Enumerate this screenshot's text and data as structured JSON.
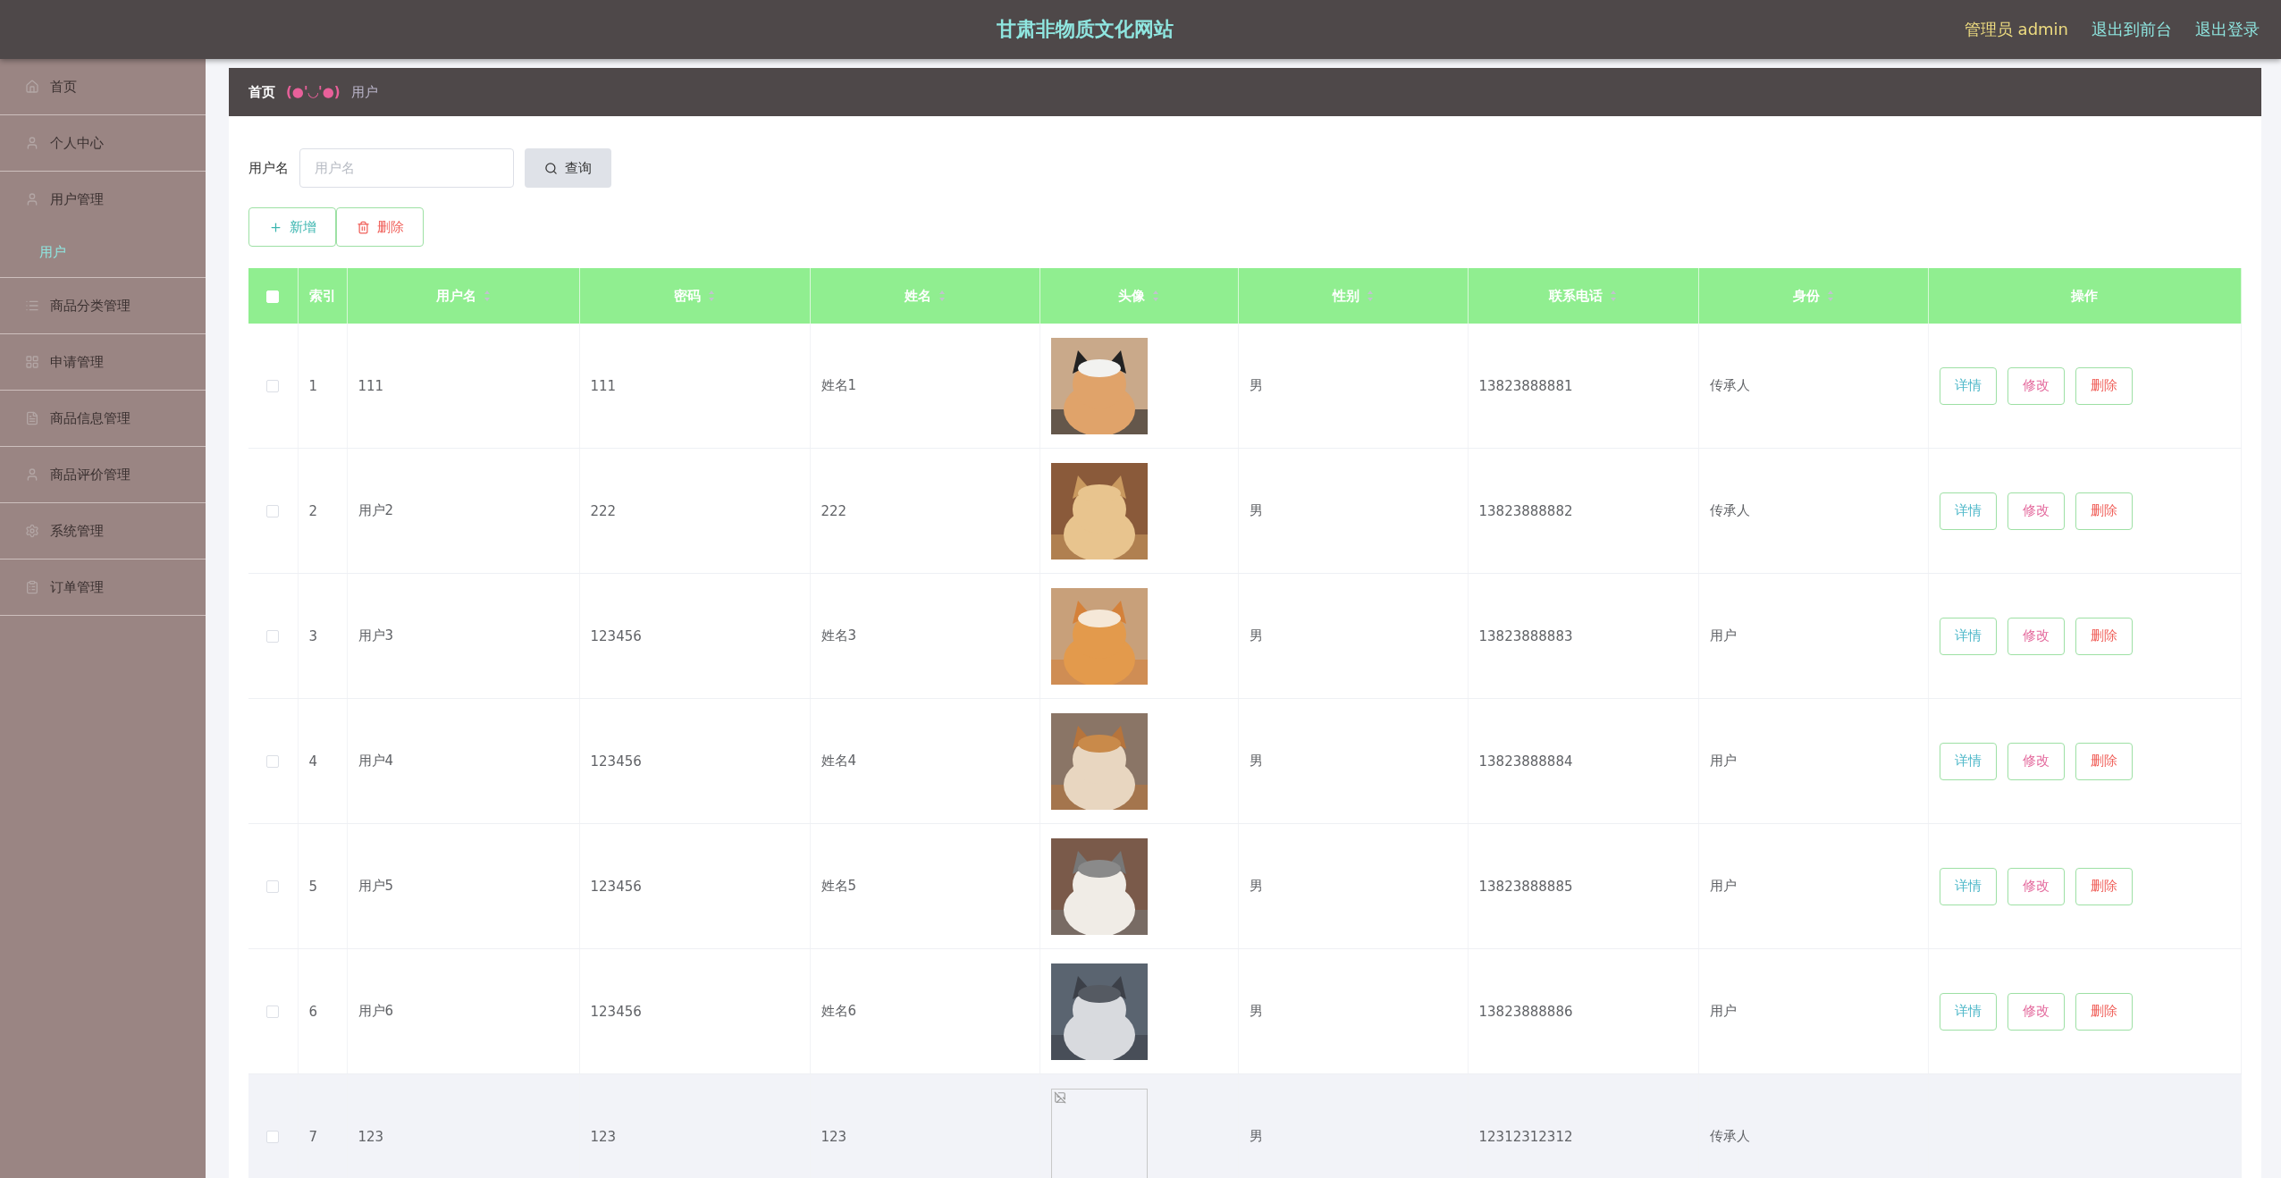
{
  "header": {
    "title": "甘肃非物质文化网站",
    "user": "管理员 admin",
    "links": [
      "退出到前台",
      "退出登录"
    ]
  },
  "sidebar": {
    "items": [
      {
        "label": "首页",
        "selected": false
      },
      {
        "label": "个人中心",
        "selected": false
      },
      {
        "label": "用户管理",
        "selected": false,
        "children": [
          {
            "label": "用户",
            "selected": true
          }
        ]
      },
      {
        "label": "商品分类管理",
        "selected": false
      },
      {
        "label": "申请管理",
        "selected": false
      },
      {
        "label": "商品信息管理",
        "selected": false
      },
      {
        "label": "商品评价管理",
        "selected": false
      },
      {
        "label": "系统管理",
        "selected": false
      },
      {
        "label": "订单管理",
        "selected": false
      }
    ]
  },
  "breadcrumb": {
    "home": "首页",
    "emoticon": "(●'◡'●)",
    "current": "用户"
  },
  "search": {
    "label": "用户名",
    "placeholder": "用户名",
    "button": "查询"
  },
  "toolbar": [
    {
      "kind": "add",
      "label": "新增"
    },
    {
      "kind": "delete",
      "label": "删除"
    }
  ],
  "table": {
    "select_all": {
      "checked": false
    },
    "columns": [
      {
        "label": "索引",
        "sortable": false
      },
      {
        "label": "用户名",
        "sortable": true
      },
      {
        "label": "密码",
        "sortable": true
      },
      {
        "label": "姓名",
        "sortable": true
      },
      {
        "label": "头像",
        "sortable": true
      },
      {
        "label": "性别",
        "sortable": true
      },
      {
        "label": "联系电话",
        "sortable": true
      },
      {
        "label": "身份",
        "sortable": true
      },
      {
        "label": "操作",
        "sortable": false
      }
    ],
    "rows": [
      {
        "checked": false,
        "hovered": false,
        "index": "1",
        "username": "111",
        "password": "111",
        "name": "姓名1",
        "gender": "男",
        "phone": "13823888881",
        "identity": "传承人",
        "actions": [
          {
            "kind": "detail",
            "label": "详情"
          },
          {
            "kind": "edit",
            "label": "修改"
          },
          {
            "kind": "delete",
            "label": "删除"
          }
        ]
      },
      {
        "checked": false,
        "hovered": false,
        "index": "2",
        "username": "用户2",
        "password": "222",
        "name": "222",
        "gender": "男",
        "phone": "13823888882",
        "identity": "传承人",
        "actions": [
          {
            "kind": "detail",
            "label": "详情"
          },
          {
            "kind": "edit",
            "label": "修改"
          },
          {
            "kind": "delete",
            "label": "删除"
          }
        ]
      },
      {
        "checked": false,
        "hovered": false,
        "index": "3",
        "username": "用户3",
        "password": "123456",
        "name": "姓名3",
        "gender": "男",
        "phone": "13823888883",
        "identity": "用户",
        "actions": [
          {
            "kind": "detail",
            "label": "详情"
          },
          {
            "kind": "edit",
            "label": "修改"
          },
          {
            "kind": "delete",
            "label": "删除"
          }
        ]
      },
      {
        "checked": false,
        "hovered": false,
        "index": "4",
        "username": "用户4",
        "password": "123456",
        "name": "姓名4",
        "gender": "男",
        "phone": "13823888884",
        "identity": "用户",
        "actions": [
          {
            "kind": "detail",
            "label": "详情"
          },
          {
            "kind": "edit",
            "label": "修改"
          },
          {
            "kind": "delete",
            "label": "删除"
          }
        ]
      },
      {
        "checked": false,
        "hovered": false,
        "index": "5",
        "username": "用户5",
        "password": "123456",
        "name": "姓名5",
        "gender": "男",
        "phone": "13823888885",
        "identity": "用户",
        "actions": [
          {
            "kind": "detail",
            "label": "详情"
          },
          {
            "kind": "edit",
            "label": "修改"
          },
          {
            "kind": "delete",
            "label": "删除"
          }
        ]
      },
      {
        "checked": false,
        "hovered": false,
        "index": "6",
        "username": "用户6",
        "password": "123456",
        "name": "姓名6",
        "gender": "男",
        "phone": "13823888886",
        "identity": "用户",
        "actions": [
          {
            "kind": "detail",
            "label": "详情"
          },
          {
            "kind": "edit",
            "label": "修改"
          },
          {
            "kind": "delete",
            "label": "删除"
          }
        ]
      },
      {
        "checked": false,
        "hovered": true,
        "index": "7",
        "username": "123",
        "password": "123",
        "name": "123",
        "avatar": {
          "kind": "broken"
        },
        "gender": "男",
        "phone": "12312312312",
        "identity": "传承人"
      }
    ]
  }
}
